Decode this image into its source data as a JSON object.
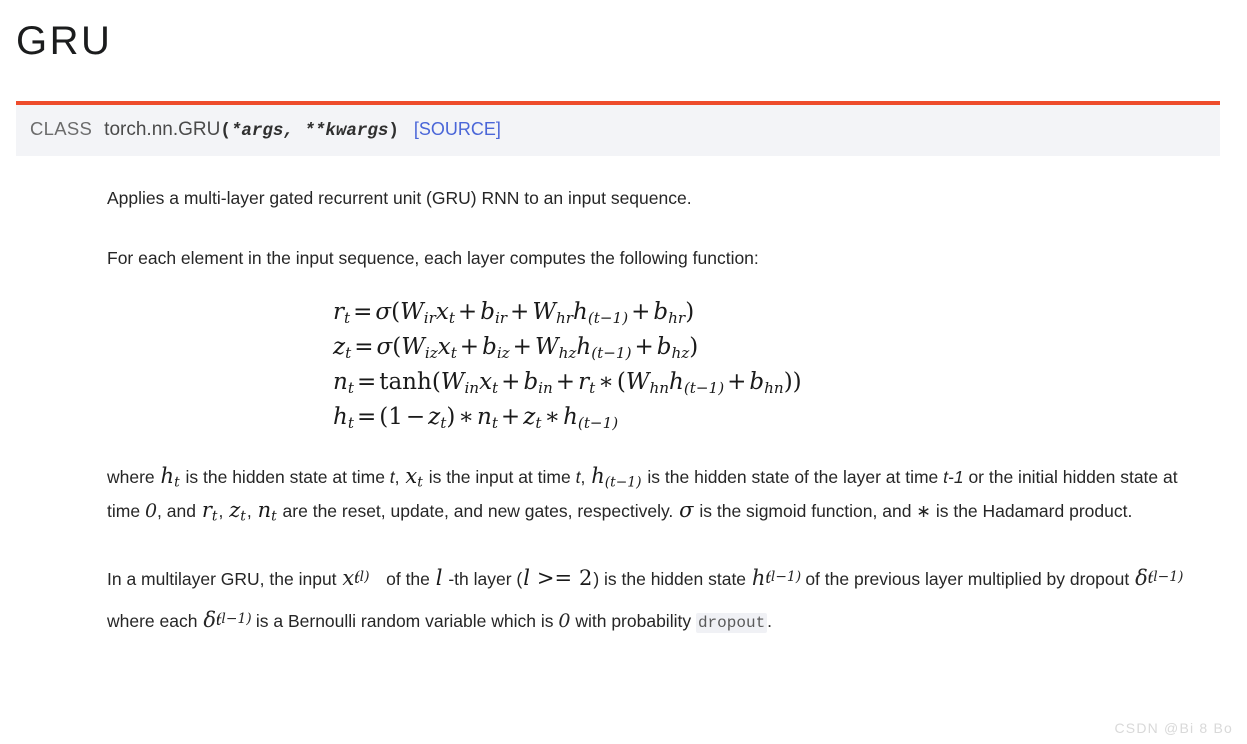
{
  "page": {
    "title": "GRU",
    "watermark": "CSDN @Bi  8  Bo"
  },
  "signature": {
    "class_label": "CLASS",
    "qualified_name": "torch.nn.GRU",
    "open_paren": "(",
    "args": "*args, **kwargs",
    "close_paren": ")",
    "source_link": "[SOURCE]",
    "accent_color": "#ee4c2c",
    "bar_background": "#f3f4f7",
    "link_color": "#4a66d8"
  },
  "body": {
    "p_applies": "Applies a multi-layer gated recurrent unit (GRU) RNN to an input sequence.",
    "p_foreach": "For each element in the input sequence, each layer computes the following function:",
    "equations": [
      {
        "lhs": "r",
        "lhs_sub": "t",
        "latex": "r_t = \\sigma(W_{ir} x_t + b_{ir} + W_{hr} h_{(t-1)} + b_{hr})",
        "plain": "r_t = σ(W_ir x_t + b_ir + W_hr h_(t-1) + b_hr)"
      },
      {
        "lhs": "z",
        "lhs_sub": "t",
        "latex": "z_t = \\sigma(W_{iz} x_t + b_{iz} + W_{hz} h_{(t-1)} + b_{hz})",
        "plain": "z_t = σ(W_iz x_t + b_iz + W_hz h_(t-1) + b_hz)"
      },
      {
        "lhs": "n",
        "lhs_sub": "t",
        "latex": "n_t = \\tanh(W_{in} x_t + b_{in} + r_t * (W_{hn} h_{(t-1)} + b_{hn}))",
        "plain": "n_t = tanh(W_in x_t + b_in + r_t * (W_hn h_(t-1) + b_hn))"
      },
      {
        "lhs": "h",
        "lhs_sub": "t",
        "latex": "h_t = (1 - z_t) * n_t + z_t * h_{(t-1)}",
        "plain": "h_t = (1 - z_t) * n_t + z_t * h_(t-1)"
      }
    ],
    "where_paragraph": {
      "seg_1": "where ",
      "seg_2": " is the hidden state at time ",
      "seg_t1": "t",
      "seg_3": ", ",
      "seg_4": " is the input at time ",
      "seg_t2": "t",
      "seg_5": ", ",
      "seg_6": " is the hidden state of the layer at time ",
      "seg_tminus1": "t-1",
      "seg_7": " or the initial hidden state at time ",
      "seg_zero": "0",
      "seg_8": ", and ",
      "seg_9": ", ",
      "seg_10": ", ",
      "seg_11": " are the reset, update, and new gates, respectively. ",
      "seg_12": " is the sigmoid function, and ",
      "seg_13": " is the Hadamard product."
    },
    "multilayer_paragraph": {
      "seg_1": "In a multilayer GRU, the input ",
      "seg_2": " of the ",
      "seg_3": " -th layer (",
      "seg_4": " ",
      "seg_gte": ">=",
      "seg_5": " ",
      "seg_two": "2",
      "seg_6": ") is the hidden state ",
      "seg_7": " of the previous layer multiplied by dropout ",
      "seg_8": " where each ",
      "seg_9": " is a Bernoulli random variable which is ",
      "seg_zero": "0",
      "seg_10": " with probability ",
      "code_dropout": "dropout",
      "seg_11": "."
    },
    "symbols": {
      "sigma": "σ",
      "asterisk": "∗",
      "delta": "δ",
      "h": "h",
      "x": "x",
      "r": "r",
      "z": "z",
      "n": "n",
      "l": "l",
      "t": "t",
      "t_minus_1": "(t−1)",
      "l_paren": "(l)",
      "l_minus_1_paren": "(l−1)"
    }
  }
}
